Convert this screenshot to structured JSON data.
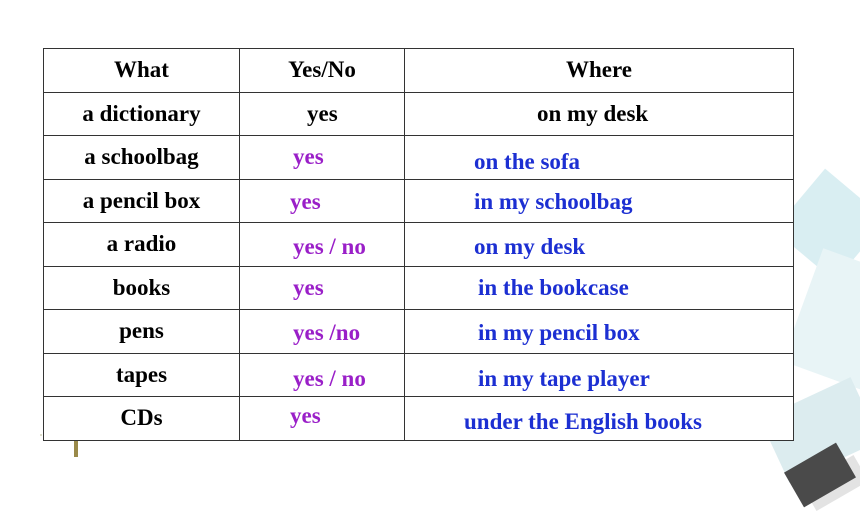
{
  "table": {
    "headers": [
      "What",
      "Yes/No",
      "Where"
    ],
    "rows": [
      {
        "what": "a dictionary",
        "yesno": "yes",
        "where": "on my desk"
      },
      {
        "what": "a schoolbag",
        "yesno": "yes",
        "where": "on the sofa"
      },
      {
        "what": "a pencil box",
        "yesno": "yes",
        "where": "in my schoolbag"
      },
      {
        "what": "a radio",
        "yesno": "yes / no",
        "where": "on my desk"
      },
      {
        "what": "books",
        "yesno": "yes",
        "where": "in the bookcase"
      },
      {
        "what": "pens",
        "yesno": "yes /no",
        "where": "in my pencil box"
      },
      {
        "what": "tapes",
        "yesno": "yes / no",
        "where": "in my tape player"
      },
      {
        "what": "CDs",
        "yesno": "yes",
        "where": "under the English books"
      }
    ]
  },
  "colors": {
    "answer_yesno": "#9a1fc8",
    "answer_where": "#1c2fd2",
    "given": "#000000"
  }
}
